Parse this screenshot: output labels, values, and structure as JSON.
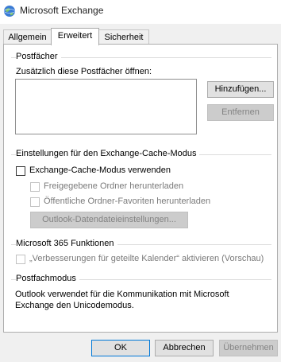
{
  "window": {
    "title": "Microsoft Exchange"
  },
  "tabs": [
    {
      "label": "Allgemein"
    },
    {
      "label": "Erweitert"
    },
    {
      "label": "Sicherheit"
    }
  ],
  "mailboxes": {
    "group_title": "Postfächer",
    "open_label": "Zusätzlich diese Postfächer öffnen:",
    "add_button": "Hinzufügen...",
    "remove_button": "Entfernen"
  },
  "cache": {
    "group_title": "Einstellungen für den Exchange-Cache-Modus",
    "use_cache_label": "Exchange-Cache-Modus verwenden",
    "shared_folders_label": "Freigegebene Ordner herunterladen",
    "public_favorites_label": "Öffentliche Ordner-Favoriten herunterladen",
    "datafile_button": "Outlook-Datendateieinstellungen..."
  },
  "m365": {
    "group_title": "Microsoft 365 Funktionen",
    "calendar_label": "„Verbesserungen für geteilte Kalender“ aktivieren (Vorschau)"
  },
  "mailbox_mode": {
    "group_title": "Postfachmodus",
    "text": "Outlook verwendet für die Kommunikation mit Microsoft Exchange den Unicodemodus."
  },
  "footer": {
    "ok": "OK",
    "cancel": "Abbrechen",
    "apply": "Übernehmen"
  },
  "colors": {
    "focus_border": "#0078d7",
    "disabled_text": "#838383"
  }
}
